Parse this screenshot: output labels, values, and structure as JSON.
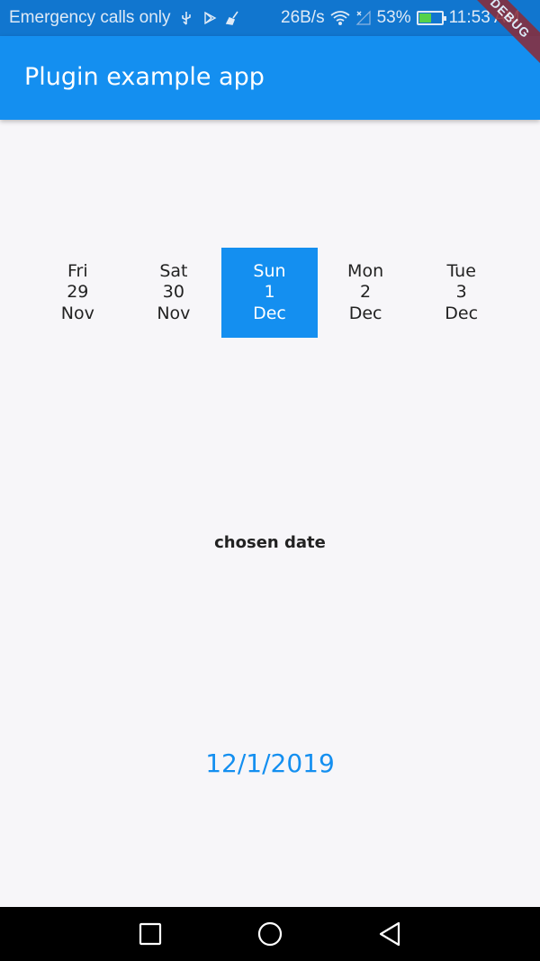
{
  "status_bar": {
    "carrier_text": "Emergency calls only",
    "net_speed": "26B/s",
    "battery_percent": "53%",
    "battery_level": 0.53,
    "time": "11:53 AM",
    "icons": [
      "usb-icon",
      "play-store-icon",
      "broom-icon",
      "wifi-icon",
      "signal-icon",
      "battery-icon"
    ]
  },
  "app_bar": {
    "title": "Plugin example app"
  },
  "debug_banner": "DEBUG",
  "date_picker": {
    "accent_color": "#148ff0",
    "selected_index": 2,
    "items": [
      {
        "weekday": "Fri",
        "day": "29",
        "month": "Nov"
      },
      {
        "weekday": "Sat",
        "day": "30",
        "month": "Nov"
      },
      {
        "weekday": "Sun",
        "day": "1",
        "month": "Dec"
      },
      {
        "weekday": "Mon",
        "day": "2",
        "month": "Dec"
      },
      {
        "weekday": "Tue",
        "day": "3",
        "month": "Dec"
      }
    ]
  },
  "chosen": {
    "label": "chosen date",
    "value": "12/1/2019"
  },
  "nav_bar": {
    "icons": [
      "recents-square-icon",
      "home-circle-icon",
      "back-triangle-icon"
    ]
  }
}
